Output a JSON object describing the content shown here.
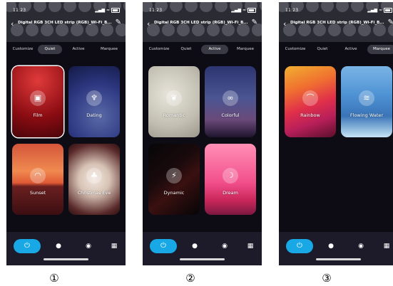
{
  "screens": [
    {
      "time": "11:23",
      "title": "Digital RGB 3CH LED strip (RGB)_Wi-Fi_B...",
      "tabs": [
        "Customize",
        "Quiet",
        "Active",
        "Marquee"
      ],
      "selected_tab": "Quiet",
      "cards": [
        {
          "label": "Film",
          "icon": "film-icon",
          "glyph": "▣",
          "selected": true
        },
        {
          "label": "Dating",
          "icon": "wine-glasses-icon",
          "glyph": "♆",
          "selected": false
        },
        {
          "label": "Sunset",
          "icon": "sunset-icon",
          "glyph": "◠",
          "selected": false
        },
        {
          "label": "Christmas Eve",
          "icon": "christmas-tree-icon",
          "glyph": "♣",
          "selected": false
        }
      ],
      "caption": "①"
    },
    {
      "time": "11:23",
      "title": "Digital RGB 3CH LED strip (RGB)_Wi-Fi_B...",
      "tabs": [
        "Customize",
        "Quiet",
        "Active",
        "Marquee"
      ],
      "selected_tab": "Active",
      "cards": [
        {
          "label": "Romantic",
          "icon": "heart-chat-icon",
          "glyph": "❦",
          "selected": false
        },
        {
          "label": "Colorful",
          "icon": "balloons-icon",
          "glyph": "∞",
          "selected": false
        },
        {
          "label": "Dynamic",
          "icon": "lightning-icon",
          "glyph": "⚡",
          "selected": false
        },
        {
          "label": "Dream",
          "icon": "moon-icon",
          "glyph": "☽",
          "selected": false
        }
      ],
      "caption": "②"
    },
    {
      "time": "11:23",
      "title": "Digital RGB 3CH LED strip (RGB)_Wi-Fi_B...",
      "tabs": [
        "Customize",
        "Quiet",
        "Active",
        "Marquee"
      ],
      "selected_tab": "Marquee",
      "cards": [
        {
          "label": "Rainbow",
          "icon": "rainbow-icon",
          "glyph": "⌒",
          "selected": false
        },
        {
          "label": "Flowing Water",
          "icon": "water-waves-icon",
          "glyph": "≋",
          "selected": false
        }
      ],
      "caption": "③"
    }
  ],
  "bottom_nav": [
    {
      "name": "power-icon",
      "glyph": "⏻",
      "active": true
    },
    {
      "name": "bulb-icon",
      "glyph": "●",
      "active": false
    },
    {
      "name": "palette-icon",
      "glyph": "◉",
      "active": false
    },
    {
      "name": "grid-icon",
      "glyph": "▦",
      "active": false
    }
  ],
  "colors": {
    "accent": "#19a8e6",
    "background": "#0d0b14",
    "header": "#2b2b34",
    "bottom_bar": "#1d1b2a"
  }
}
